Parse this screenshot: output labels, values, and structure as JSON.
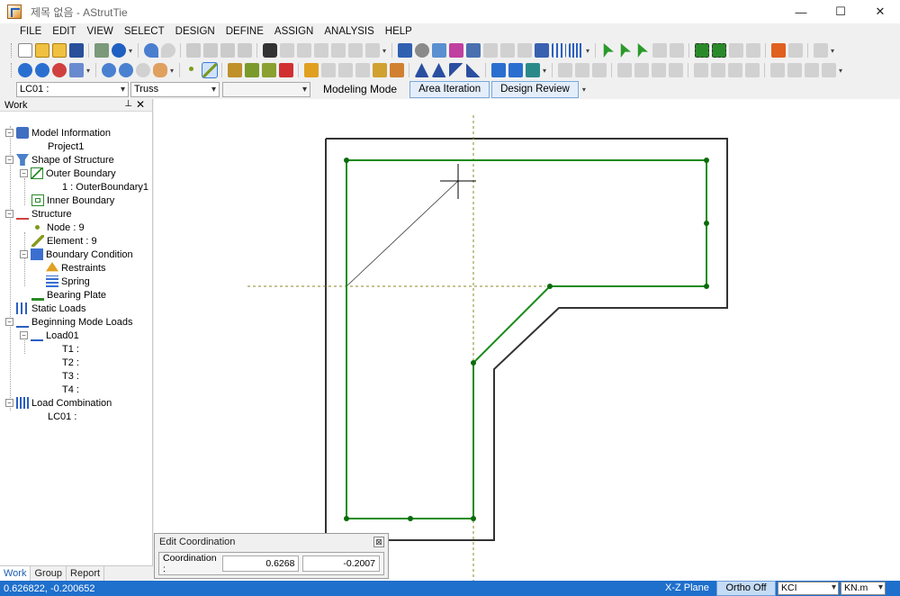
{
  "window": {
    "title": "제목 없음 - AStrutTie",
    "controls": [
      "—",
      "☐",
      "✕"
    ]
  },
  "menu": [
    "FILE",
    "EDIT",
    "VIEW",
    "SELECT",
    "DESIGN",
    "DEFINE",
    "ASSIGN",
    "ANALYSIS",
    "HELP"
  ],
  "options": {
    "load_case": "LC01 :",
    "analysis_type": "Truss",
    "third_combo": "",
    "mode_label": "Modeling Mode",
    "area_iteration": "Area Iteration",
    "design_review": "Design Review"
  },
  "work_panel": {
    "title": "Work",
    "pin": "📌",
    "close": "✕",
    "tree": {
      "model_information": "Model Information",
      "project": "Project1",
      "shape_of_structure": "Shape of Structure",
      "outer_boundary": "Outer Boundary",
      "outer_boundary_1": "1 : OuterBoundary1",
      "inner_boundary": "Inner Boundary",
      "structure": "Structure",
      "node": "Node : 9",
      "element": "Element : 9",
      "boundary_condition": "Boundary Condition",
      "restraints": "Restraints",
      "spring": "Spring",
      "bearing_plate": "Bearing Plate",
      "static_loads": "Static Loads",
      "beginning_mode_loads": "Beginning Mode Loads",
      "load01": "Load01",
      "t1": "T1 :",
      "t2": "T2 :",
      "t3": "T3 :",
      "t4": "T4 :",
      "load_combination": "Load Combination",
      "lc01": "LC01 :"
    },
    "tabs": [
      "Work",
      "Group",
      "Report"
    ]
  },
  "dialog": {
    "title": "Edit Coordination",
    "close": "⊠",
    "label": "Coordination :",
    "x": "0.6268",
    "y": "-0.2007"
  },
  "status": {
    "coords": "0.626822, -0.200652",
    "plane": "X-Z Plane",
    "ortho": "Ortho Off",
    "code": "KCI",
    "unit": "KN.m"
  },
  "colors": {
    "accent": "#1f6fcc",
    "structure_green": "#1a8c1a",
    "node_green": "#0b6b0b",
    "boundary": "#333333",
    "guide_olive": "#8a8a2a"
  }
}
